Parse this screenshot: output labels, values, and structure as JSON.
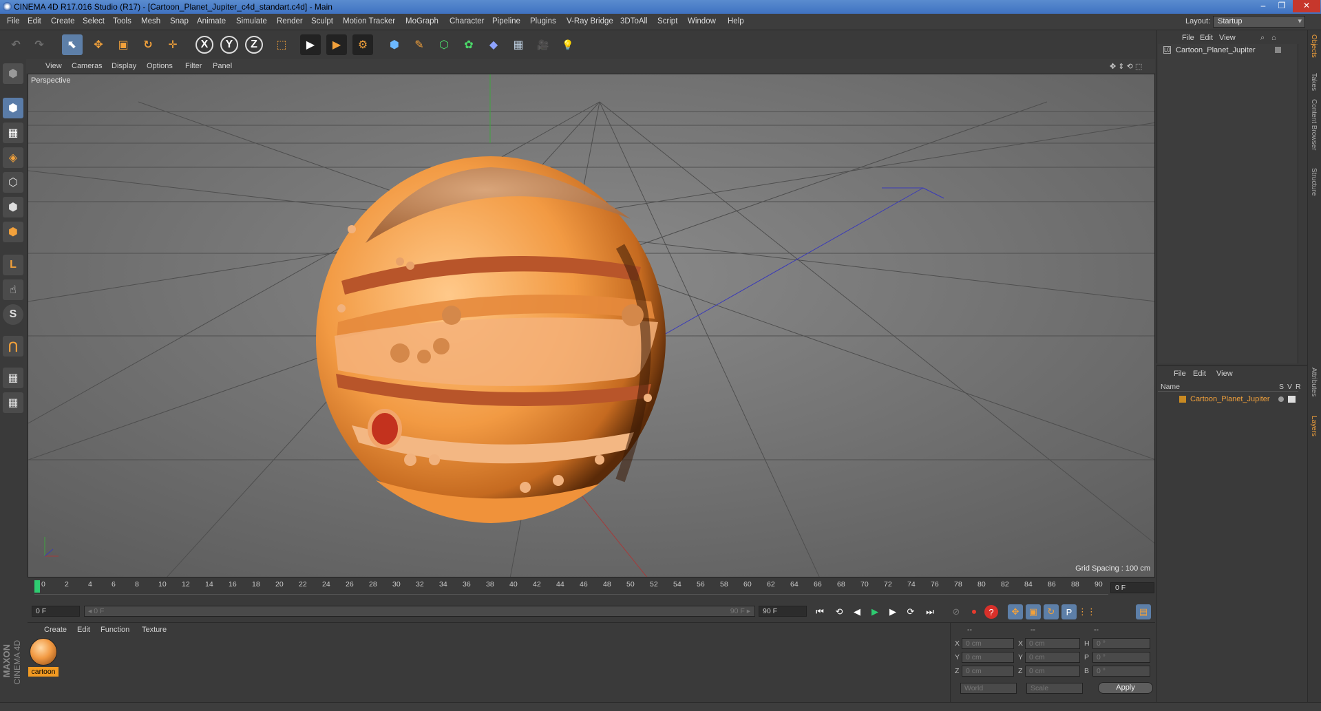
{
  "window": {
    "title": "CINEMA 4D R17.016 Studio (R17) - [Cartoon_Planet_Jupiter_c4d_standart.c4d] - Main",
    "min": "‒",
    "max": "❐",
    "close": "✕"
  },
  "menus": [
    "File",
    "Edit",
    "Create",
    "Select",
    "Tools",
    "Mesh",
    "Snap",
    "Animate",
    "Simulate",
    "Render",
    "Sculpt",
    "Motion Tracker",
    "MoGraph",
    "Character",
    "Pipeline",
    "Plugins",
    "V-Ray Bridge",
    "3DToAll",
    "Script",
    "Window",
    "Help"
  ],
  "layout": {
    "label": "Layout:",
    "value": "Startup"
  },
  "toolbar": {
    "undo": "↶",
    "redo": "↷",
    "select": "⬉",
    "move": "✥",
    "scale": "▣",
    "rotate": "↻",
    "coords": "✛",
    "x": "X",
    "y": "Y",
    "z": "Z",
    "world": "⬚",
    "render_view": "▶",
    "render_pic": "▶",
    "render_settings": "⚙",
    "cube": "⬢",
    "pen": "✎",
    "subdiv": "⬡",
    "cloner": "✿",
    "deformer": "◆",
    "floor": "▦",
    "camera": "🎥",
    "light": "💡"
  },
  "left_tools": {
    "model": "⬢",
    "texture": "▦",
    "polygons": "◈",
    "points": "⬡",
    "edges": "⬢",
    "objects": "⬢",
    "axis": "L",
    "mouse": "☝",
    "snap": "S",
    "magnet": "⋂",
    "workplane": "▦",
    "lock": "▦"
  },
  "viewport": {
    "menu": [
      "View",
      "Cameras",
      "Display",
      "Options",
      "Filter",
      "Panel"
    ],
    "label": "Perspective",
    "grid_spacing": "Grid Spacing : 100 cm",
    "nav_icons": "✥ ⇕ ⟲ ⬚"
  },
  "timeline": {
    "ticks": [
      "0",
      "2",
      "4",
      "6",
      "8",
      "10",
      "12",
      "14",
      "16",
      "18",
      "20",
      "22",
      "24",
      "26",
      "28",
      "30",
      "32",
      "34",
      "36",
      "38",
      "40",
      "42",
      "44",
      "46",
      "48",
      "50",
      "52",
      "54",
      "56",
      "58",
      "60",
      "62",
      "64",
      "66",
      "68",
      "70",
      "72",
      "74",
      "76",
      "78",
      "80",
      "82",
      "84",
      "86",
      "88",
      "90"
    ],
    "current": "0 F",
    "start": "0 F",
    "range_start": "◂ 0 F",
    "range_end": "90 F ▸",
    "end": "90 F"
  },
  "transport": {
    "first": "⏮",
    "prev_key": "⟲",
    "prev": "◀",
    "play": "▶",
    "next": "▶",
    "next_key": "⟳",
    "last": "⏭",
    "keyframe": "⊘",
    "record": "⏺",
    "autokey": "?",
    "move_key": "✥",
    "scale_key": "▣",
    "rot_key": "↻",
    "param_key": "P",
    "grid_key": "⋮⋮",
    "timeline_btn": "▤"
  },
  "material_manager": {
    "menu": [
      "Create",
      "Edit",
      "Function",
      "Texture"
    ],
    "materials": [
      {
        "name": "cartoon"
      }
    ]
  },
  "coordinates": {
    "headers": [
      "--",
      "--",
      "--"
    ],
    "rows": [
      {
        "a": "X",
        "av": "0 cm",
        "b": "X",
        "bv": "0 cm",
        "c": "H",
        "cv": "0 °"
      },
      {
        "a": "Y",
        "av": "0 cm",
        "b": "Y",
        "bv": "0 cm",
        "c": "P",
        "cv": "0 °"
      },
      {
        "a": "Z",
        "av": "0 cm",
        "b": "Z",
        "bv": "0 cm",
        "c": "B",
        "cv": "0 °"
      }
    ],
    "space": "World",
    "mode": "Scale",
    "apply": "Apply"
  },
  "object_manager": {
    "menu": [
      "File",
      "Edit",
      "View"
    ],
    "objects": [
      {
        "name": "Cartoon_Planet_Jupiter"
      }
    ]
  },
  "layer_manager": {
    "menu": [
      "File",
      "Edit",
      "View"
    ],
    "columns": {
      "name": "Name",
      "s": "S",
      "v": "V",
      "r": "R"
    },
    "layers": [
      {
        "name": "Cartoon_Planet_Jupiter"
      }
    ]
  },
  "side_tabs": [
    "Objects",
    "Takes",
    "Content Browser",
    "Structure",
    "Attributes",
    "Layers"
  ],
  "brand": {
    "maxon": "MAXON",
    "product": "CINEMA 4D"
  },
  "colors": {
    "accent": "#f29a22",
    "selection": "#5d7fa8",
    "viewport_bg": "#6a6a6a"
  }
}
